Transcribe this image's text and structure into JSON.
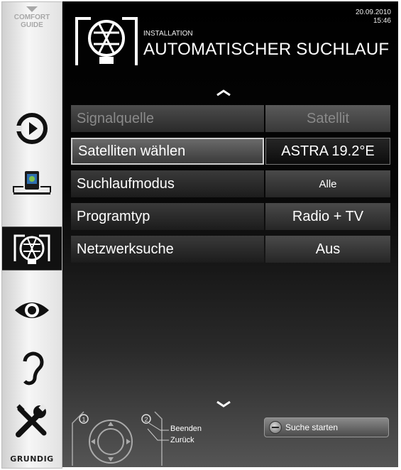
{
  "sidebar": {
    "comfort_guide": [
      "COMFORT",
      "GUIDE"
    ],
    "items": [
      {
        "icon": "source-play-icon"
      },
      {
        "icon": "media-device-icon"
      },
      {
        "icon": "installation-dish-icon",
        "active": true
      },
      {
        "icon": "eye-picture-icon"
      },
      {
        "icon": "ear-sound-icon"
      },
      {
        "icon": "tools-settings-icon"
      }
    ],
    "brand": "GRUNDIG"
  },
  "header": {
    "date": "20.09.2010",
    "time": "15:46",
    "section": "INSTALLATION",
    "title": "AUTOMATISCHER SUCHLAUF"
  },
  "menu": {
    "rows": [
      {
        "label": "Signalquelle",
        "value": "Satellit",
        "state": "disabled"
      },
      {
        "label": "Satelliten wählen",
        "value": "ASTRA 19.2°E",
        "state": "selected"
      },
      {
        "label": "Suchlaufmodus",
        "value": "Alle",
        "state": "normal"
      },
      {
        "label": "Programtyp",
        "value": "Radio + TV",
        "state": "normal"
      },
      {
        "label": "Netzwerksuche",
        "value": "Aus",
        "state": "normal"
      }
    ]
  },
  "footer": {
    "key1": "1",
    "key2": "2",
    "exit_label": "Beenden",
    "back_label": "Zurück",
    "start_button_label": "Suche starten"
  },
  "colors": {
    "panel_bg": "#000000",
    "sidebar_bg": "#e6e6e6",
    "text": "#ffffff",
    "disabled_text": "#8a8a8a"
  }
}
